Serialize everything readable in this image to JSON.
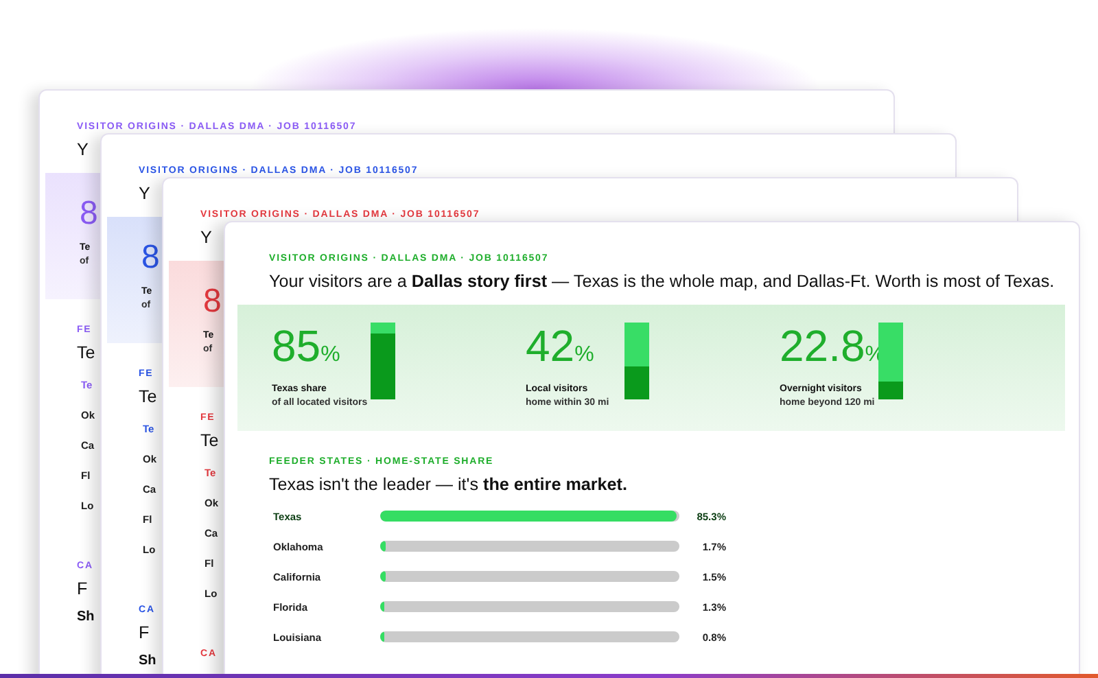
{
  "cards": [
    {
      "color": "#8b5cf6",
      "eyebrow": "VISITOR ORIGINS · DALLAS DMA · JOB 10116507",
      "headline": "Y",
      "stats": [
        {
          "value": "8",
          "label": "Te",
          "sub": "of"
        }
      ],
      "section": {
        "eyebrow": "FE",
        "title": "Te",
        "rows": [
          {
            "label": "Te",
            "leader": true
          },
          {
            "label": "Ok",
            "leader": false
          },
          {
            "label": "Ca",
            "leader": false
          },
          {
            "label": "Fl",
            "leader": false
          },
          {
            "label": "Lo",
            "leader": false
          }
        ]
      },
      "next_section": {
        "eyebrow": "CA",
        "title": "F",
        "subtitle": "Sh"
      }
    },
    {
      "color": "#2b55e6",
      "eyebrow": "VISITOR ORIGINS · DALLAS DMA · JOB 10116507",
      "headline": "Y",
      "stats": [
        {
          "value": "8",
          "label": "Te",
          "sub": "of"
        }
      ],
      "section": {
        "eyebrow": "FE",
        "title": "Te",
        "rows": [
          {
            "label": "Te",
            "leader": true
          },
          {
            "label": "Ok",
            "leader": false
          },
          {
            "label": "Ca",
            "leader": false
          },
          {
            "label": "Fl",
            "leader": false
          },
          {
            "label": "Lo",
            "leader": false
          }
        ]
      },
      "next_section": {
        "eyebrow": "CA",
        "title": "F",
        "subtitle": "Sh"
      }
    },
    {
      "color": "#e5393f",
      "eyebrow": "VISITOR ORIGINS · DALLAS DMA · JOB 10116507",
      "headline": "Y",
      "stats": [
        {
          "value": "8",
          "label": "Te",
          "sub": "of"
        }
      ],
      "section": {
        "eyebrow": "FE",
        "title": "Te",
        "rows": [
          {
            "label": "Te",
            "leader": true
          },
          {
            "label": "Ok",
            "leader": false
          },
          {
            "label": "Ca",
            "leader": false
          },
          {
            "label": "Fl",
            "leader": false
          },
          {
            "label": "Lo",
            "leader": false
          }
        ]
      },
      "next_section": {
        "eyebrow": "CA"
      }
    },
    {
      "color": "#1fae2c",
      "eyebrow": "VISITOR ORIGINS · DALLAS DMA · JOB 10116507",
      "headline": "Your visitors are a **Dallas story first** — Texas is the whole map, and Dallas-Ft. Worth is most of Texas.",
      "stats": [
        {
          "value": "85",
          "unit": "%",
          "label": "Texas share",
          "sub": "of all located visitors",
          "level": 0.85
        },
        {
          "value": "42",
          "unit": "%",
          "label": "Local visitors",
          "sub": "home within 30 mi",
          "level": 0.42
        },
        {
          "value": "22.8",
          "unit": "%",
          "label": "Overnight visitors",
          "sub": "home beyond 120 mi",
          "level": 0.228
        }
      ],
      "section": {
        "eyebrow": "FEEDER STATES · HOME-STATE SHARE",
        "title": "Texas isn't the leader — it's **the entire market.**",
        "rows": [
          {
            "label": "Texas",
            "leader": true,
            "level": 0.99,
            "value": "85.3%"
          },
          {
            "label": "Oklahoma",
            "leader": false,
            "level": 0.02,
            "value": "1.7%"
          },
          {
            "label": "California",
            "leader": false,
            "level": 0.018,
            "value": "1.5%"
          },
          {
            "label": "Florida",
            "leader": false,
            "level": 0.015,
            "value": "1.3%"
          },
          {
            "label": "Louisiana",
            "leader": false,
            "level": 0.009,
            "value": "0.8%"
          }
        ]
      }
    }
  ]
}
